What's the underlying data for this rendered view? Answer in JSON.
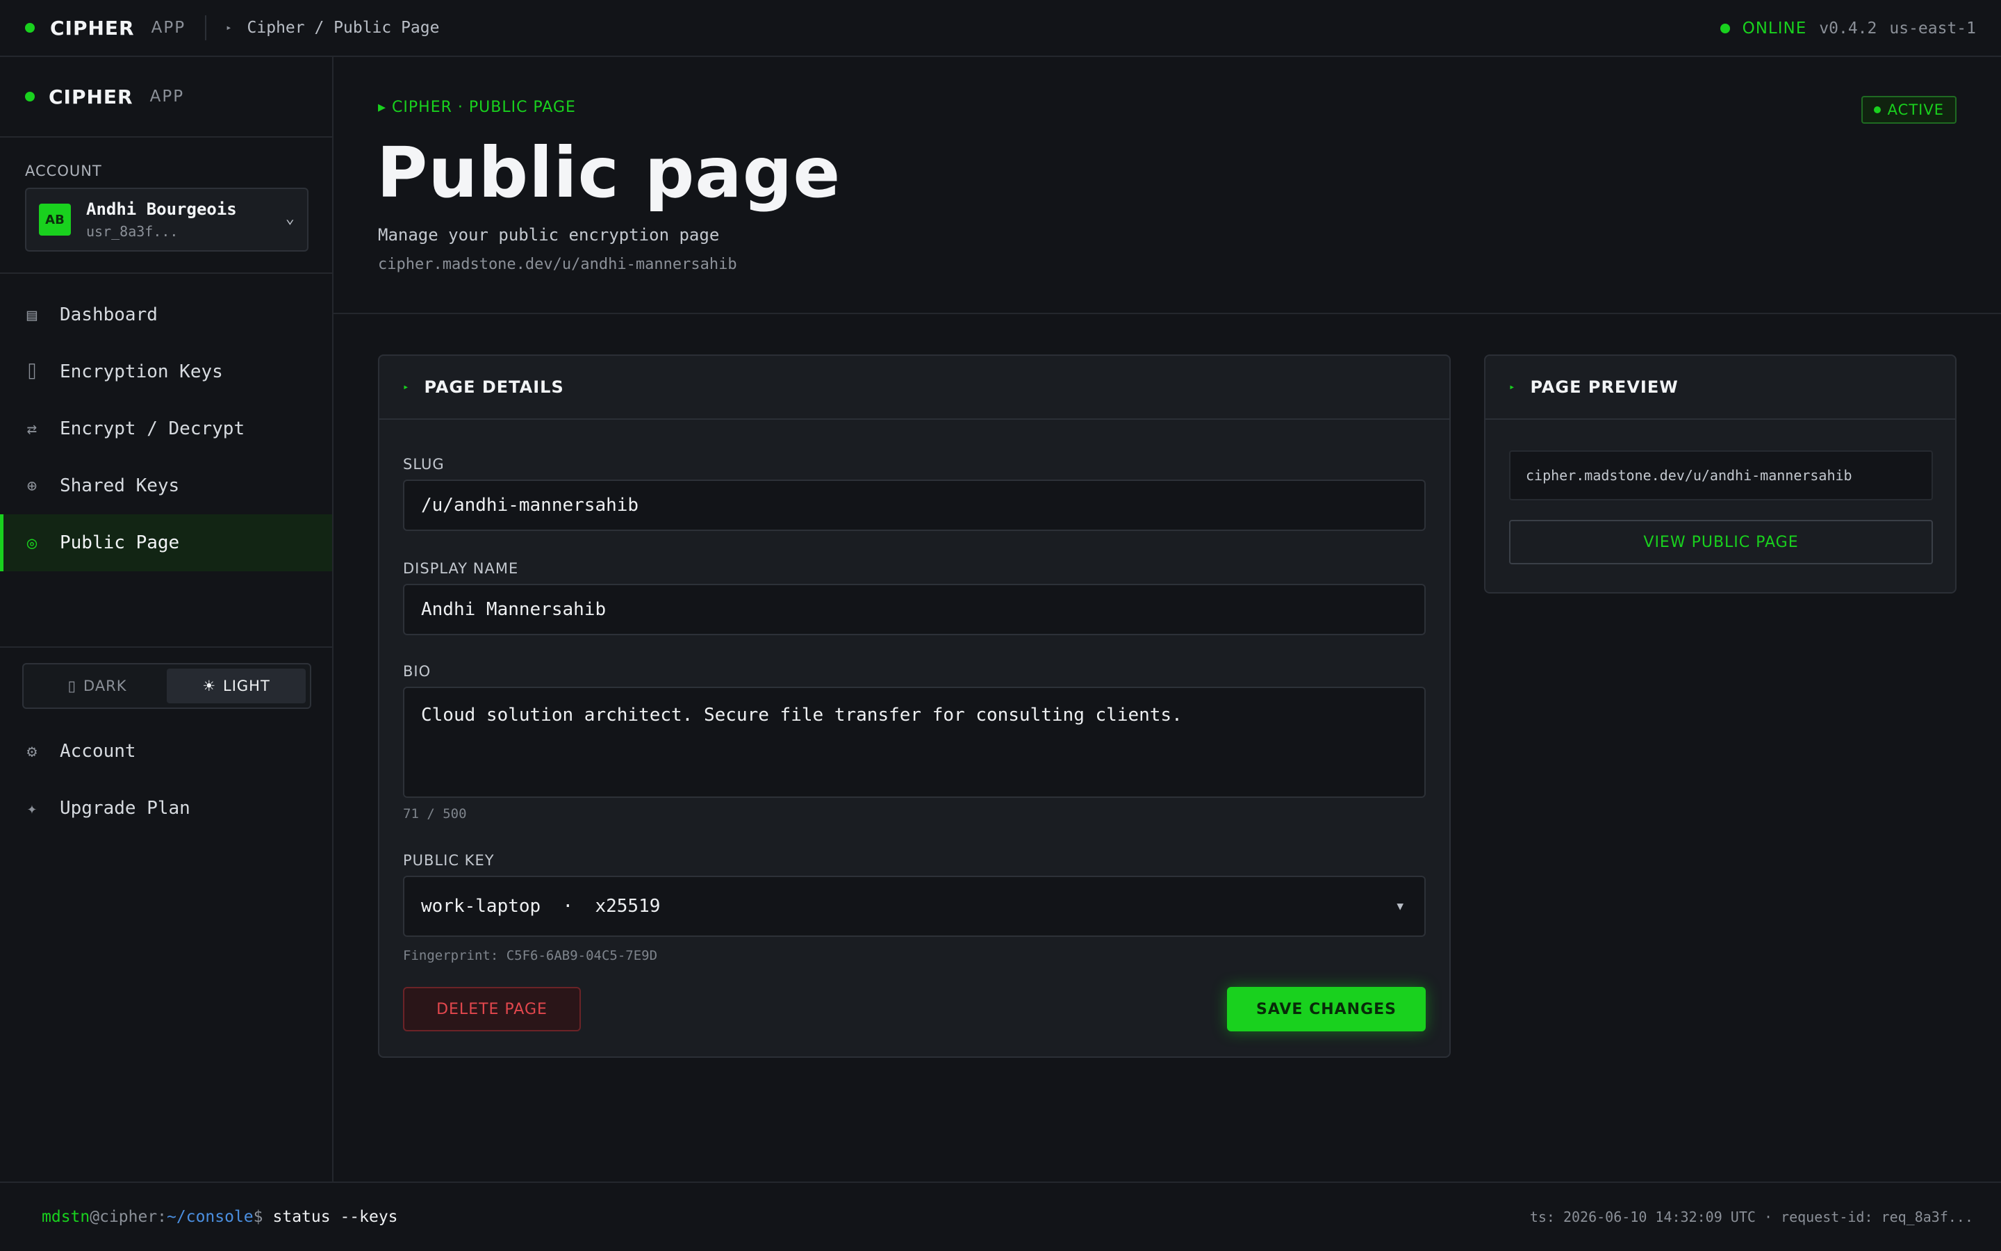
{
  "topbar": {
    "brand": "CIPHER",
    "brand_sub": "APP",
    "breadcrumb": "Cipher / Public Page",
    "status": "ONLINE",
    "version": "v0.4.2",
    "region": "us-east-1"
  },
  "sidebar": {
    "brand": "CIPHER",
    "brand_sub": "APP",
    "account_label": "ACCOUNT",
    "account": {
      "initials": "AB",
      "name": "Andhi Bourgeois",
      "id": "usr_8a3f..."
    },
    "nav": [
      {
        "label": "Dashboard",
        "icon": "grid-icon",
        "glyph": "▤"
      },
      {
        "label": "Encryption Keys",
        "icon": "key-icon",
        "glyph": "⌷"
      },
      {
        "label": "Encrypt / Decrypt",
        "icon": "swap-icon",
        "glyph": "⇄"
      },
      {
        "label": "Shared Keys",
        "icon": "globe-icon",
        "glyph": "⊕"
      },
      {
        "label": "Public Page",
        "icon": "target-icon",
        "glyph": "◎"
      }
    ],
    "theme": {
      "dark": "DARK",
      "light": "LIGHT",
      "dark_glyph": "▯",
      "light_glyph": "☀",
      "selected": "light"
    },
    "nav_bottom": [
      {
        "label": "Account",
        "icon": "gear-icon",
        "glyph": "⚙"
      },
      {
        "label": "Upgrade Plan",
        "icon": "sparkle-icon",
        "glyph": "✦"
      }
    ]
  },
  "page": {
    "kicker": "▸ CIPHER · PUBLIC PAGE",
    "title": "Public page",
    "subtitle": "Manage your public encryption page",
    "url": "cipher.madstone.dev/u/andhi-mannersahib",
    "badge": "ACTIVE"
  },
  "details": {
    "title": "PAGE DETAILS",
    "slug_label": "SLUG",
    "slug_value": "/u/andhi-mannersahib",
    "display_name_label": "DISPLAY NAME",
    "display_name_value": "Andhi Mannersahib",
    "bio_label": "BIO",
    "bio_value": "Cloud solution architect. Secure file transfer for consulting clients.",
    "bio_count": "71 / 500",
    "public_key_label": "PUBLIC KEY",
    "public_key_value": "work-laptop  ·  x25519",
    "fingerprint": "Fingerprint: C5F6-6AB9-04C5-7E9D",
    "delete_label": "DELETE PAGE",
    "save_label": "SAVE CHANGES"
  },
  "preview": {
    "title": "PAGE PREVIEW",
    "url": "cipher.madstone.dev/u/andhi-mannersahib",
    "view_label": "VIEW PUBLIC PAGE"
  },
  "footer": {
    "user": "mdstn",
    "at": "@cipher:",
    "path": "~/console",
    "dollar": "$",
    "command": "status --keys",
    "meta": "ts: 2026-06-10 14:32:09 UTC · request-id: req_8a3f..."
  },
  "colors": {
    "accent": "#19d11e",
    "danger": "#e2474d",
    "background": "#121418",
    "panel": "#1a1d22"
  }
}
